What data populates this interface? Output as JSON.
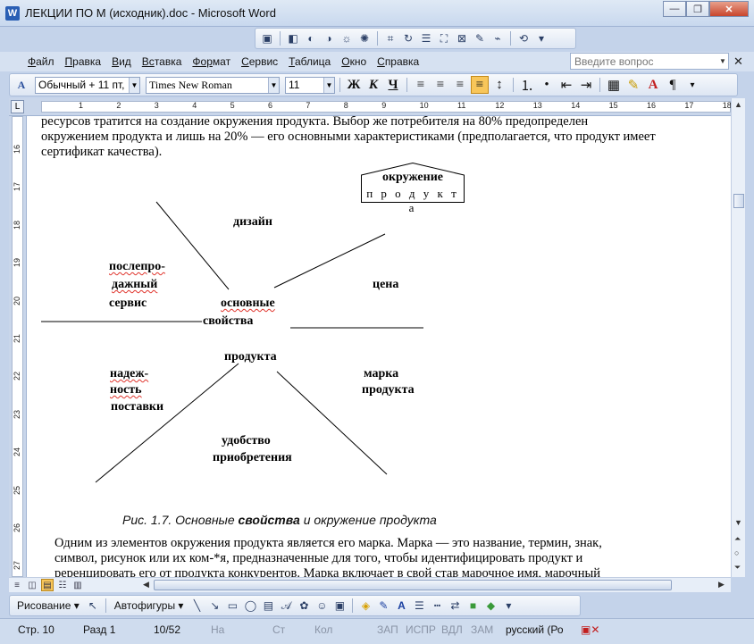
{
  "window": {
    "title": "ЛЕКЦИИ ПО М (исходник).doc - Microsoft Word",
    "minimize": "—",
    "restore": "❐",
    "close": "✕"
  },
  "menu": {
    "items": [
      {
        "key": "Ф",
        "rest": "айл"
      },
      {
        "key": "П",
        "rest": "равка"
      },
      {
        "key": "В",
        "rest": "ид"
      },
      {
        "key": "Вс",
        "rest": "тавка"
      },
      {
        "key": "Фор",
        "rest": "мат"
      },
      {
        "key": "С",
        "rest": "ервис"
      },
      {
        "key": "Т",
        "rest": "аблица"
      },
      {
        "key": "О",
        "rest": "кно"
      },
      {
        "key": "С",
        "rest": "правка"
      }
    ],
    "help_placeholder": "Введите вопрос",
    "close_doc": "✕"
  },
  "format_toolbar": {
    "style": "Обычный + 11 пт,",
    "font": "Times New Roman",
    "size": "11",
    "bold": "Ж",
    "italic": "К",
    "underline": "Ч",
    "pilcrow": "¶"
  },
  "ruler": {
    "h_ticks": [
      "1",
      "2",
      "3",
      "4",
      "5",
      "6",
      "7",
      "8",
      "9",
      "10",
      "11",
      "12",
      "13",
      "14",
      "15",
      "16",
      "17",
      "18"
    ],
    "v_ticks": [
      "16",
      "17",
      "18",
      "19",
      "20",
      "21",
      "22",
      "23",
      "24",
      "25",
      "26",
      "27"
    ]
  },
  "document": {
    "para_top_line1": "ресурсов тратится на создание окружения продукта. Выбор же потребителя на 80% предопределен",
    "para_top_line2": "окружением продукта и лишь на 20% — его основными характеристиками (предполагается, что продукт имеет",
    "para_top_line3": "сертификат качества).",
    "diagram": {
      "box_line1": "окружение",
      "box_line2": "п р о д у к т а",
      "design": "дизайн",
      "aftersale_1": "послепро-",
      "aftersale_2": "дажный",
      "aftersale_3": "сервис",
      "price": "цена",
      "core_1": "основные",
      "core_2": "свойства",
      "core_3": "продукта",
      "reliab_1": "надеж-",
      "reliab_2": "ность",
      "reliab_3": "поставки",
      "brand_1": "марка",
      "brand_2": "продукта",
      "conv_1": "удобство",
      "conv_2": "приобретения"
    },
    "caption_pre": "Рис. 1.7. Основные ",
    "caption_bold": "свойства",
    "caption_post": " и окружение продукта",
    "para_bottom_line1": "Одним из элементов окружения продукта является его марка. Марка — это название, термин, знак,",
    "para_bottom_line2": "символ, рисунок или их ком-*я, предназначенные для того, чтобы идентифицировать продукт и",
    "para_bottom_line3": "реренцировать его от продукта конкурентов. Марка включает в свой став марочное имя, марочный"
  },
  "draw_toolbar": {
    "drawing": "Рисование",
    "autoshapes": "Автофигуры"
  },
  "status": {
    "page": "Стр.  10",
    "section": "Разд  1",
    "pages": "10/52",
    "at": "На",
    "line": "Ст",
    "col": "Кол",
    "rec": "ЗАП",
    "trk": "ИСПР",
    "ext": "ВДЛ",
    "ovr": "ЗАМ",
    "lang": "русский (Ро"
  }
}
